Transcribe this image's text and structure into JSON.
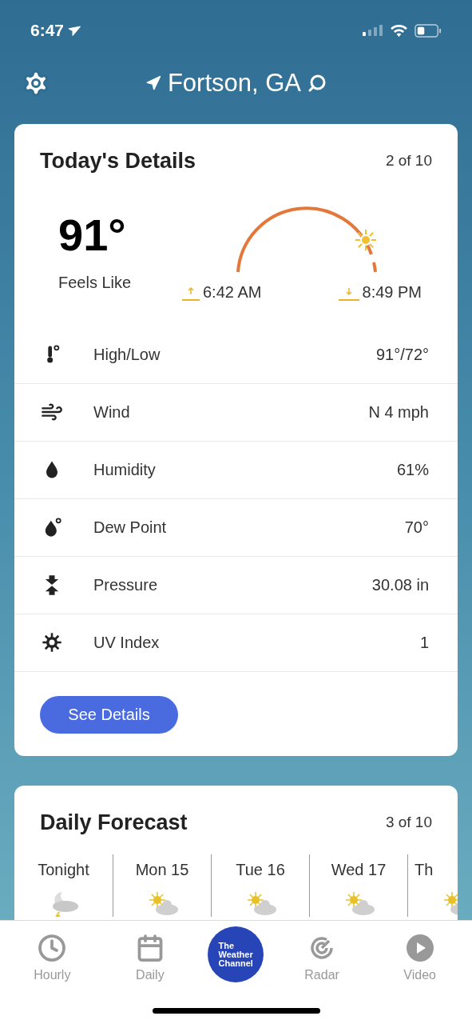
{
  "status_bar": {
    "time": "6:47"
  },
  "header": {
    "location": "Fortson, GA"
  },
  "details_card": {
    "title": "Today's Details",
    "pager": "2 of 10",
    "feels_like": {
      "temp": "91°",
      "label": "Feels Like"
    },
    "sunrise": "6:42 AM",
    "sunset": "8:49 PM",
    "rows": [
      {
        "label": "High/Low",
        "value": "91°/72°"
      },
      {
        "label": "Wind",
        "value": "N 4 mph"
      },
      {
        "label": "Humidity",
        "value": "61%"
      },
      {
        "label": "Dew Point",
        "value": "70°"
      },
      {
        "label": "Pressure",
        "value": "30.08 in"
      },
      {
        "label": "UV Index",
        "value": "1"
      }
    ],
    "button": "See Details"
  },
  "forecast_card": {
    "title": "Daily Forecast",
    "pager": "3 of 10",
    "days": [
      {
        "label": "Tonight",
        "kind": "night"
      },
      {
        "label": "Mon 15",
        "kind": "day"
      },
      {
        "label": "Tue 16",
        "kind": "day"
      },
      {
        "label": "Wed 17",
        "kind": "day"
      },
      {
        "label": "Th",
        "kind": "day"
      }
    ]
  },
  "tab_bar": {
    "logo": [
      "The",
      "Weather",
      "Channel"
    ],
    "tabs": [
      {
        "label": "Hourly",
        "selected": false
      },
      {
        "label": "Daily",
        "selected": false
      },
      {
        "label": "Radar",
        "selected": false
      },
      {
        "label": "Video",
        "selected": false
      }
    ]
  }
}
